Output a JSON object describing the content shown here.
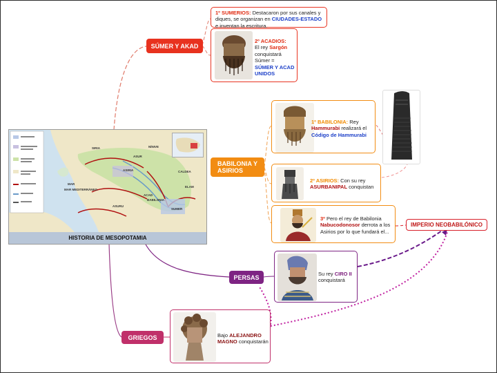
{
  "map": {
    "title": "HISTORIA DE MESOPOTAMIA",
    "labels": [
      "ASIRIA",
      "ACAD",
      "SUMER",
      "BABILONIA",
      "ASURU",
      "ASUR",
      "CALDEA",
      "MAR MEDITERRÁNEO",
      "MAR",
      "SIRIA",
      "NÍNIVE",
      "ELAM"
    ]
  },
  "branches": {
    "sumer": "SÚMER Y AKAD",
    "babilonia": "BABILONIA Y ASIRIOS",
    "persas": "PERSAS",
    "griegos": "GRIEGOS",
    "imperio": "IMPERIO NEOBABILÓNICO"
  },
  "cards": {
    "sumerios": {
      "head": "1º SUMERIOS:",
      "t1": " Destacaron por sus canales y diques, se organizan en ",
      "hl": "CIUDADES-ESTADO",
      "t2": " e inventan la escritura."
    },
    "acadios": {
      "head": "2º ACADIOS:",
      "t1": "El rey ",
      "hl1": "Sargón",
      "t2": " conquistará Súmer =",
      "hl2": "SÚMER Y ACAD UNIDOS"
    },
    "babilonia": {
      "head": "1º BABILONIA:",
      "t1": " Rey ",
      "hl1": "Hammurabi",
      "t2": " realizará el ",
      "hl2": "Código de Hammurabi"
    },
    "asirios": {
      "head": "2º ASIRIOS:",
      "t1": " Con su rey ",
      "hl1": "ASURBANIPAL",
      "t2": " conquistan"
    },
    "neobab": {
      "head": "3º",
      "t1": " Pero el rey de Babilonia ",
      "hl1": "Nabucodonosor",
      "t2": " derrota a los Asirios por lo que fundará el..."
    },
    "persas": {
      "t1": "Su rey ",
      "hl1": "CIRO II",
      "t2": " conquistará"
    },
    "griegos": {
      "t1": "Bajo ",
      "hl1": "ALEJANDRO MAGNO",
      "t2": " conquistarán"
    }
  },
  "colors": {
    "sumer": "#e8321f",
    "babilonia": "#f28c12",
    "persas": "#7e2483",
    "griegos": "#c0306a",
    "imperio_border": "#d8202a"
  },
  "icons": [
    "sargon-head-icon",
    "hammurabi-head-icon",
    "hammurabi-stele-icon",
    "ashurbanipal-relief-icon",
    "nebuchadnezzar-icon",
    "cyrus-icon",
    "alexander-icon",
    "map-inset-icon"
  ]
}
